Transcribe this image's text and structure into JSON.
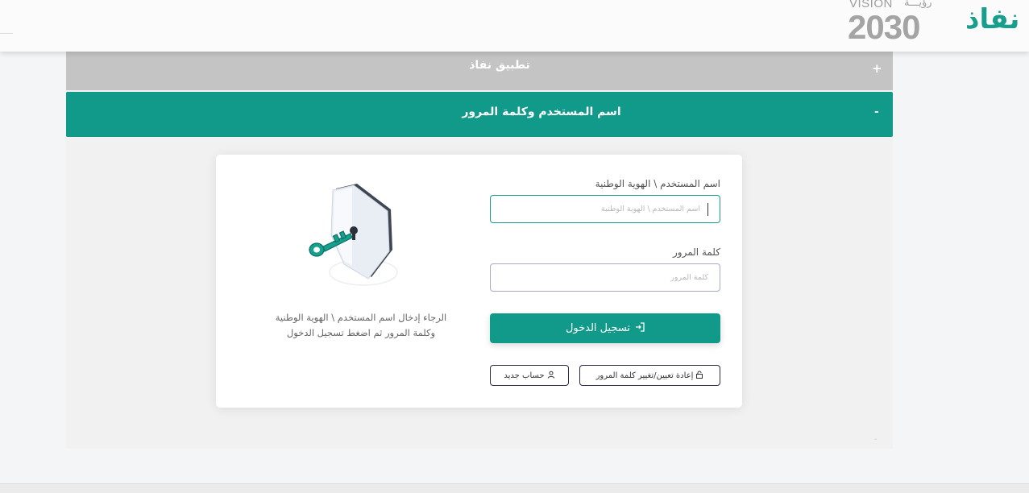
{
  "header": {
    "logo_text": "نفاذ",
    "vision_label": "VISION",
    "vision_ar": "رؤيـــة",
    "vision_year": "2030"
  },
  "accordion": {
    "app_section": {
      "title": "تطبيق نفاذ",
      "toggle": "+"
    },
    "login_section": {
      "title": "اسم المستخدم وكلمة المرور",
      "toggle": "-"
    }
  },
  "form": {
    "username_label": "اسم المستخدم \\ الهوية الوطنية",
    "username_placeholder": "اسم المستخدم \\ الهوية الوطنية",
    "password_label": "كلمة المرور",
    "password_placeholder": "كلمة المرور",
    "login_button": "تسجيل الدخول",
    "reset_button": "إعادة تعيين/تغيير كلمة المرور",
    "new_account_button": "حساب جديد"
  },
  "instructions": {
    "line1": "الرجاء إدخال اسم المستخدم \\ الهوية الوطنية",
    "line2": "وكلمة المرور ثم اضغط تسجيل الدخول"
  },
  "colors": {
    "accent": "#11998a",
    "collapsed_header": "#c4c4c4",
    "panel_bg": "#f1f1f1"
  },
  "icons": [
    "sign-in-icon",
    "lock-icon",
    "user-icon",
    "shield-key-icon",
    "vision-emblem-icon"
  ]
}
